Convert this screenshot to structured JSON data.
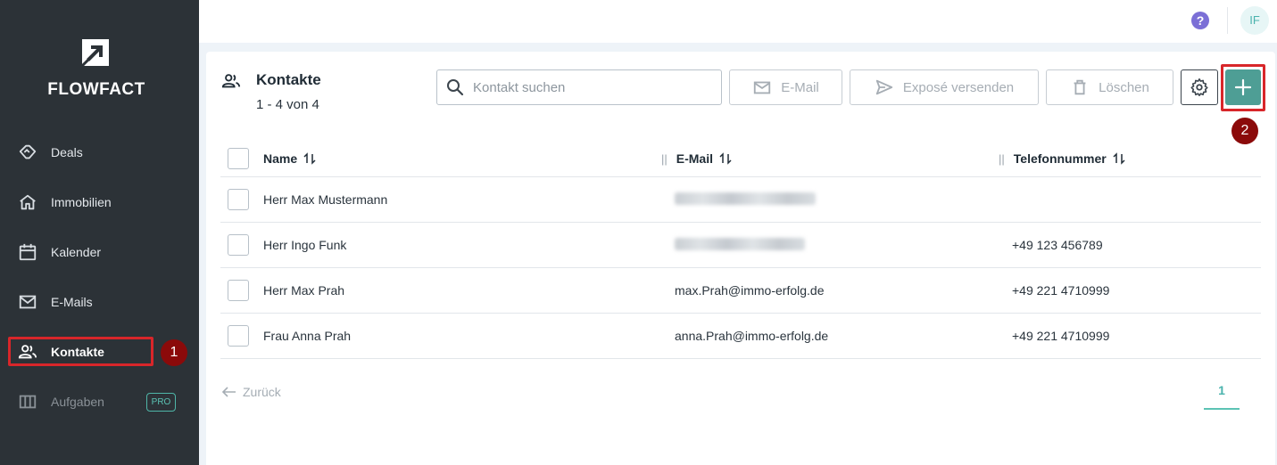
{
  "app": {
    "brand": "FLOWFACT",
    "avatar_initials": "IF"
  },
  "sidebar": {
    "items": [
      {
        "label": "Deals",
        "icon": "handshake-icon"
      },
      {
        "label": "Immobilien",
        "icon": "home-icon"
      },
      {
        "label": "Kalender",
        "icon": "calendar-icon"
      },
      {
        "label": "E-Mails",
        "icon": "mail-icon"
      },
      {
        "label": "Kontakte",
        "icon": "contacts-icon",
        "active": true
      },
      {
        "label": "Aufgaben",
        "icon": "board-icon",
        "disabled": true,
        "badge": "PRO"
      }
    ]
  },
  "annotations": {
    "step1": "1",
    "step2": "2",
    "highlight_color": "#d8262a",
    "badge_color": "#8b0a0a"
  },
  "page": {
    "title": "Kontakte",
    "count": "1 - 4 von 4"
  },
  "toolbar": {
    "search_placeholder": "Kontakt suchen",
    "email_label": "E-Mail",
    "expose_label": "Exposé versenden",
    "delete_label": "Löschen",
    "add_label": "+"
  },
  "table": {
    "columns": [
      "Name",
      "E-Mail",
      "Telefonnummer"
    ],
    "rows": [
      {
        "name": "Herr Max Mustermann",
        "email": "",
        "email_blurred": true,
        "phone": ""
      },
      {
        "name": "Herr Ingo Funk",
        "email": "",
        "email_blurred": true,
        "phone": "+49 123 456789"
      },
      {
        "name": "Herr Max Prah",
        "email": "max.Prah@immo-erfolg.de",
        "phone": "+49 221 4710999"
      },
      {
        "name": "Frau Anna Prah",
        "email": "anna.Prah@immo-erfolg.de",
        "phone": "+49 221 4710999"
      }
    ]
  },
  "pagination": {
    "back_label": "Zurück",
    "current_page": "1"
  },
  "colors": {
    "sidebar_bg": "#2c3237",
    "accent": "#4e9e95",
    "accent_text": "#4ab3ad",
    "help_icon": "#7b6fd6"
  }
}
